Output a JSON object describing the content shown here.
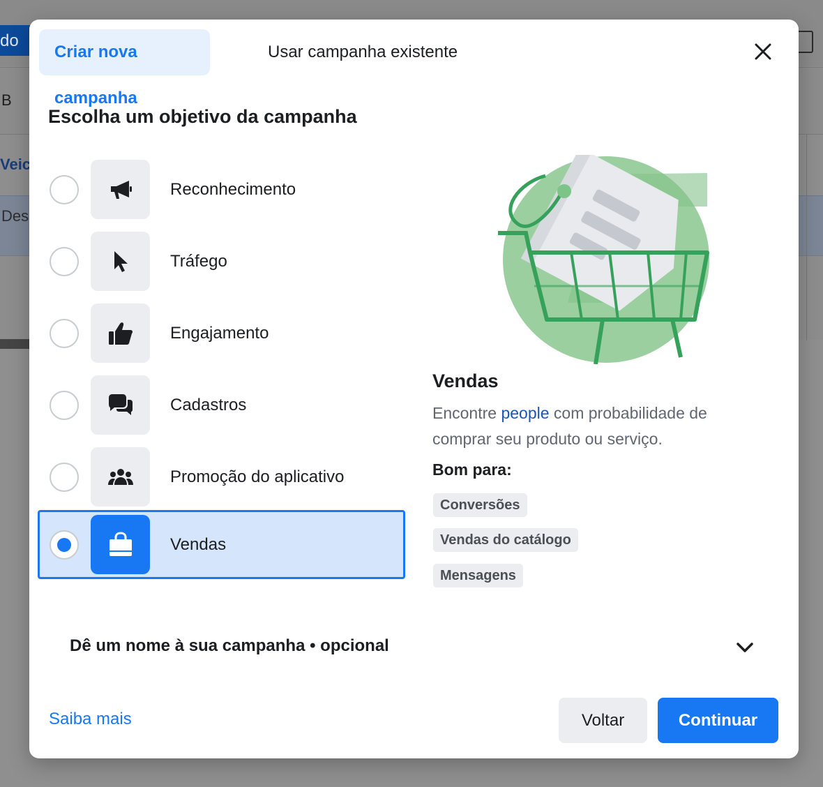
{
  "background": {
    "button_label": "do",
    "row1_text": "B",
    "row2_text": "Veic",
    "row3_text": "Des"
  },
  "tabs": {
    "active": "Criar nova campanha",
    "other": "Usar campanha existente"
  },
  "section_title": "Escolha um objetivo da campanha",
  "objectives": [
    {
      "label": "Reconhecimento",
      "icon": "megaphone-icon",
      "selected": false
    },
    {
      "label": "Tráfego",
      "icon": "cursor-icon",
      "selected": false
    },
    {
      "label": "Engajamento",
      "icon": "thumbs-up-icon",
      "selected": false
    },
    {
      "label": "Cadastros",
      "icon": "chat-bubbles-icon",
      "selected": false
    },
    {
      "label": "Promoção do aplicativo",
      "icon": "people-group-icon",
      "selected": false
    },
    {
      "label": "Vendas",
      "icon": "shopping-bag-icon",
      "selected": true
    }
  ],
  "detail": {
    "title": "Vendas",
    "desc_prefix": "Encontre ",
    "desc_link": "people",
    "desc_suffix": " com probabilidade de comprar seu produto ou serviço.",
    "good_for_label": "Bom para:",
    "tags": [
      "Conversões",
      "Vendas do catálogo",
      "Mensagens"
    ]
  },
  "campaign_name_label": "Dê um nome à sua campanha • opcional",
  "footer": {
    "learn_more": "Saiba mais",
    "back": "Voltar",
    "continue": "Continuar"
  },
  "colors": {
    "accent": "#1877f2",
    "selected_bg": "#d5e5fb",
    "illustration_green": "#9bcf9f",
    "illustration_dark_green": "#36a15a"
  }
}
